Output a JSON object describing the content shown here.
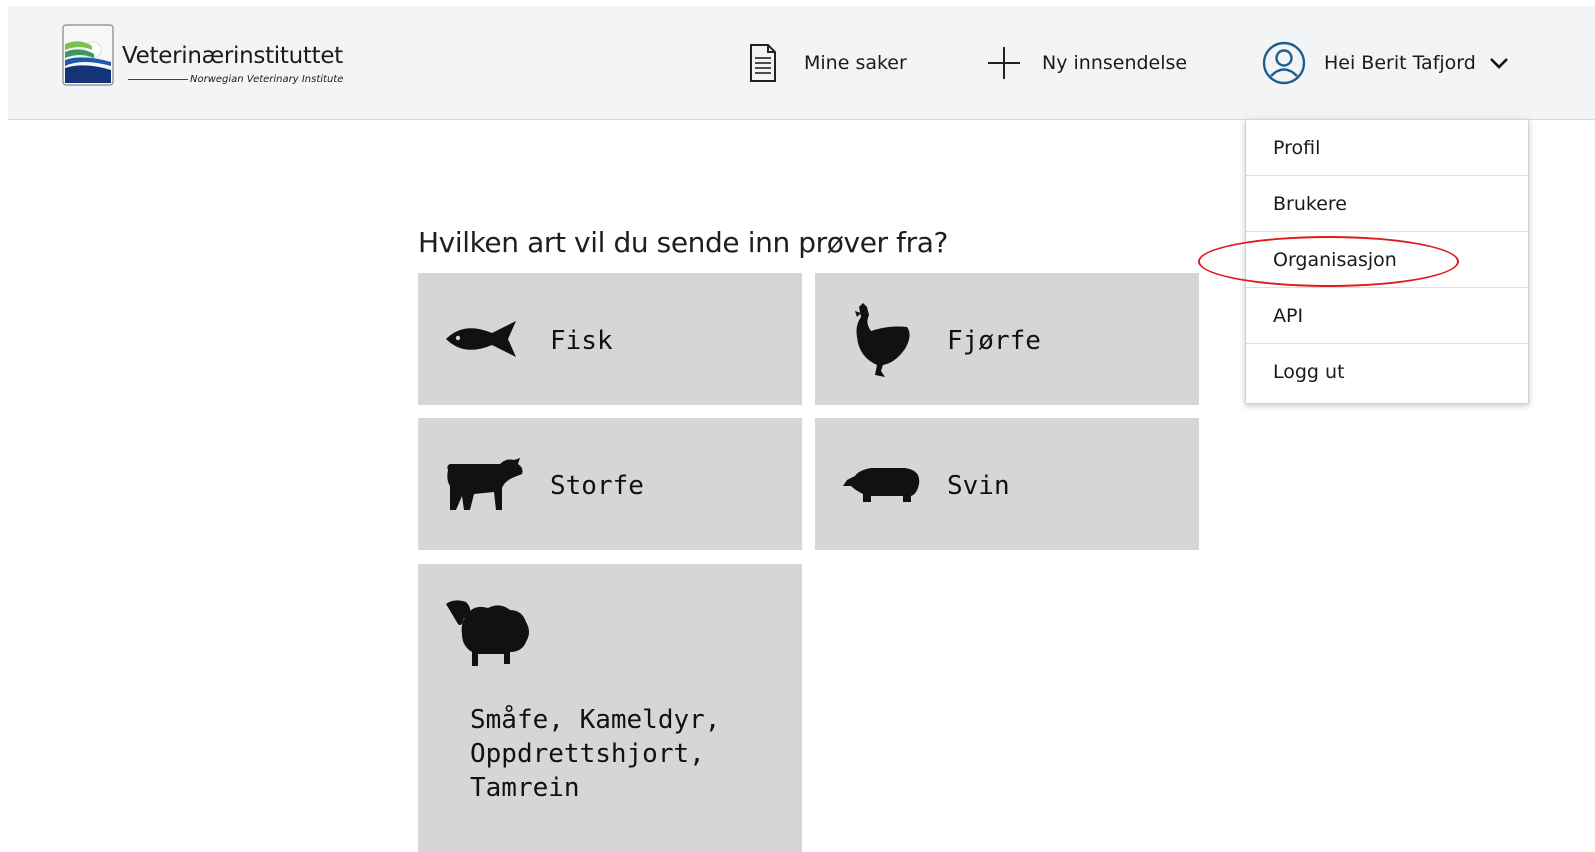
{
  "header": {
    "logo": {
      "name": "Veterinærinstituttet",
      "subtitle": "Norwegian Veterinary Institute",
      "icon": "veterinary-institute-logo"
    },
    "nav": {
      "mine_saker": "Mine saker",
      "ny_innsendelse": "Ny innsendelse",
      "user_greeting": "Hei Berit Tafjord"
    },
    "icons": {
      "mine_saker": "document-icon",
      "ny_innsendelse": "plus-icon",
      "user": "user-circle-icon",
      "chevron": "chevron-down-icon"
    }
  },
  "user_menu": {
    "items": [
      "Profil",
      "Brukere",
      "Organisasjon",
      "API",
      "Logg ut"
    ],
    "highlighted": "Organisasjon",
    "annotation_color": "#e01a1a"
  },
  "main": {
    "question": "Hvilken art vil du sende inn prøver fra?",
    "species": [
      {
        "label": "Fisk",
        "icon": "fish-icon"
      },
      {
        "label": "Fjørfe",
        "icon": "chicken-icon"
      },
      {
        "label": "Storfe",
        "icon": "cow-icon"
      },
      {
        "label": "Svin",
        "icon": "pig-icon"
      },
      {
        "label": "Småfe, Kameldyr,\nOppdrettshjort,\nTamrein",
        "icon": "sheep-icon"
      }
    ],
    "card_color": "#d6d6d6"
  }
}
